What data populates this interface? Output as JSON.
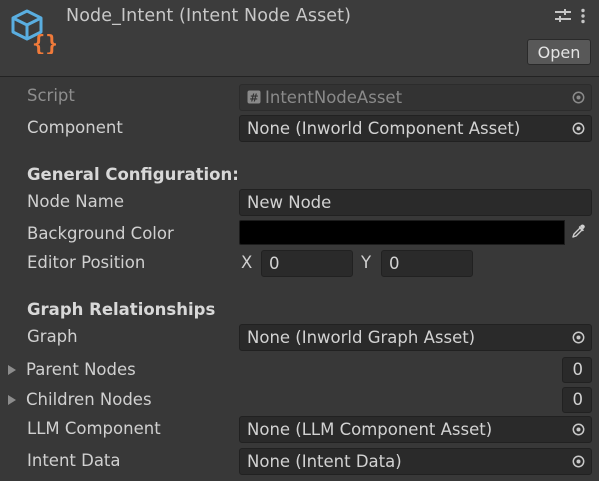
{
  "header": {
    "title": "Node_Intent (Intent Node Asset)",
    "open_label": "Open"
  },
  "script": {
    "label": "Script",
    "value": "IntentNodeAsset"
  },
  "component": {
    "label": "Component",
    "value": "None (Inworld Component Asset)"
  },
  "general": {
    "heading": "General Configuration:",
    "node_name_label": "Node Name",
    "node_name_value": "New Node",
    "bg_color_label": "Background Color",
    "bg_color_value": "#000000",
    "editor_position_label": "Editor Position",
    "x_label": "X",
    "x_value": "0",
    "y_label": "Y",
    "y_value": "0"
  },
  "graph_rel": {
    "heading": "Graph Relationships",
    "graph_label": "Graph",
    "graph_value": "None (Inworld Graph Asset)",
    "parent_label": "Parent Nodes",
    "parent_count": "0",
    "children_label": "Children Nodes",
    "children_count": "0",
    "llm_label": "LLM Component",
    "llm_value": "None (LLM Component Asset)",
    "intent_label": "Intent Data",
    "intent_value": "None (Intent Data)"
  },
  "colors": {
    "background": "#383838",
    "field": "#2a2a2a",
    "icon_accent": "#4fa3d6",
    "icon_braces": "#f07a3a"
  }
}
